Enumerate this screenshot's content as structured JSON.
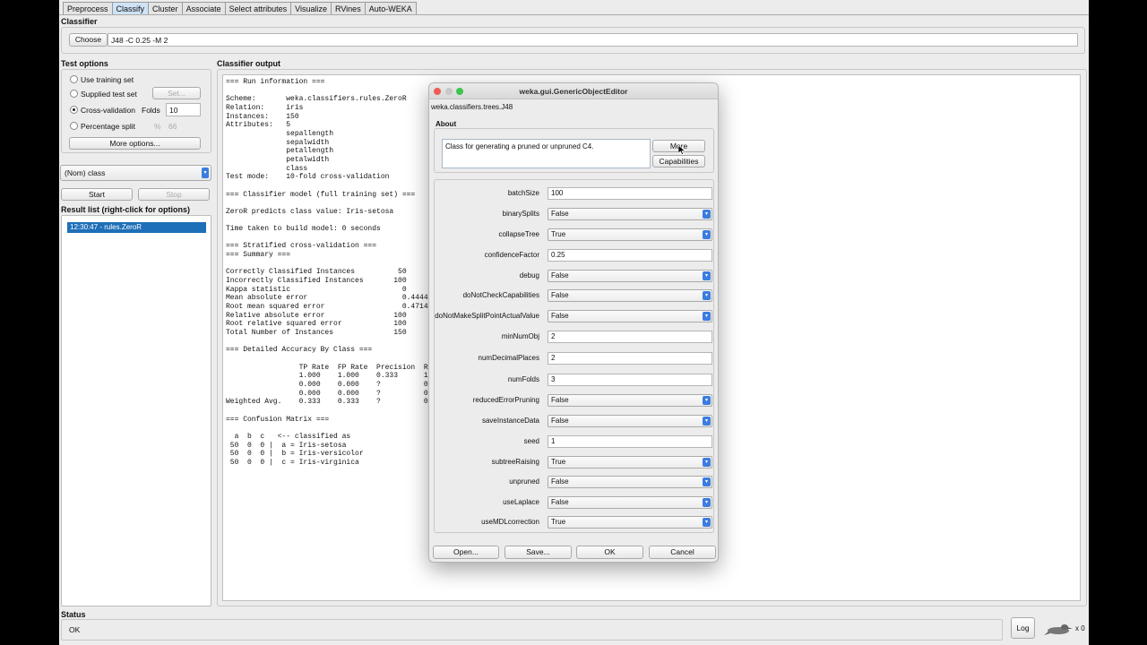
{
  "tabs": [
    "Preprocess",
    "Classify",
    "Cluster",
    "Associate",
    "Select attributes",
    "Visualize",
    "RVines",
    "Auto-WEKA"
  ],
  "classifier": {
    "section_label": "Classifier",
    "choose_label": "Choose",
    "spec": "J48 -C 0.25 -M 2"
  },
  "test_options": {
    "label": "Test options",
    "use_training": "Use training set",
    "supplied": "Supplied test set",
    "set_label": "Set...",
    "cross_val": "Cross-validation",
    "folds_label": "Folds",
    "folds_value": "10",
    "pct_split": "Percentage split",
    "pct_symbol": "%",
    "pct_value": "66",
    "more_options": "More options..."
  },
  "class_select": "(Nom) class",
  "start_label": "Start",
  "stop_label": "Stop",
  "result_list": {
    "label": "Result list (right-click for options)",
    "items": [
      "12:30:47 - rules.ZeroR"
    ]
  },
  "output": {
    "label": "Classifier output",
    "text": "=== Run information ===\n\nScheme:       weka.classifiers.rules.ZeroR\nRelation:     iris\nInstances:    150\nAttributes:   5\n              sepallength\n              sepalwidth\n              petallength\n              petalwidth\n              class\nTest mode:    10-fold cross-validation\n\n=== Classifier model (full training set) ===\n\nZeroR predicts class value: Iris-setosa\n\nTime taken to build model: 0 seconds\n\n=== Stratified cross-validation ===\n=== Summary ===\n\nCorrectly Classified Instances          50\nIncorrectly Classified Instances       100\nKappa statistic                          0\nMean absolute error                      0.4444\nRoot mean squared error                  0.4714\nRelative absolute error                100      %\nRoot relative squared error            100      %\nTotal Number of Instances              150\n\n=== Detailed Accuracy By Class ===\n\n                 TP Rate  FP Rate  Precision  Reca\n                 1.000    1.000    0.333      1.00\n                 0.000    0.000    ?          0.00\n                 0.000    0.000    ?          0.00\nWeighted Avg.    0.333    0.333    ?          0.33\n\n=== Confusion Matrix ===\n\n  a  b  c   <-- classified as\n 50  0  0 |  a = Iris-setosa\n 50  0  0 |  b = Iris-versicolor\n 50  0  0 |  c = Iris-virginica"
  },
  "status": {
    "label": "Status",
    "text": "OK",
    "log_label": "Log",
    "count": "x 0"
  },
  "dialog": {
    "title": "weka.gui.GenericObjectEditor",
    "class_name": "weka.classifiers.trees.J48",
    "about_label": "About",
    "about_text": "Class for generating a pruned or unpruned C4.",
    "more_label": "More",
    "capabilities_label": "Capabilities",
    "properties": [
      {
        "name": "batchSize",
        "value": "100",
        "kind": "text"
      },
      {
        "name": "binarySplits",
        "value": "False",
        "kind": "combo"
      },
      {
        "name": "collapseTree",
        "value": "True",
        "kind": "combo"
      },
      {
        "name": "confidenceFactor",
        "value": "0.25",
        "kind": "text"
      },
      {
        "name": "debug",
        "value": "False",
        "kind": "combo"
      },
      {
        "name": "doNotCheckCapabilities",
        "value": "False",
        "kind": "combo"
      },
      {
        "name": "doNotMakeSplitPointActualValue",
        "value": "False",
        "kind": "combo"
      },
      {
        "name": "minNumObj",
        "value": "2",
        "kind": "text"
      },
      {
        "name": "numDecimalPlaces",
        "value": "2",
        "kind": "text"
      },
      {
        "name": "numFolds",
        "value": "3",
        "kind": "text"
      },
      {
        "name": "reducedErrorPruning",
        "value": "False",
        "kind": "combo"
      },
      {
        "name": "saveInstanceData",
        "value": "False",
        "kind": "combo"
      },
      {
        "name": "seed",
        "value": "1",
        "kind": "text"
      },
      {
        "name": "subtreeRaising",
        "value": "True",
        "kind": "combo"
      },
      {
        "name": "unpruned",
        "value": "False",
        "kind": "combo"
      },
      {
        "name": "useLaplace",
        "value": "False",
        "kind": "combo"
      },
      {
        "name": "useMDLcorrection",
        "value": "True",
        "kind": "combo"
      }
    ],
    "open_label": "Open...",
    "save_label": "Save...",
    "ok_label": "OK",
    "cancel_label": "Cancel"
  }
}
